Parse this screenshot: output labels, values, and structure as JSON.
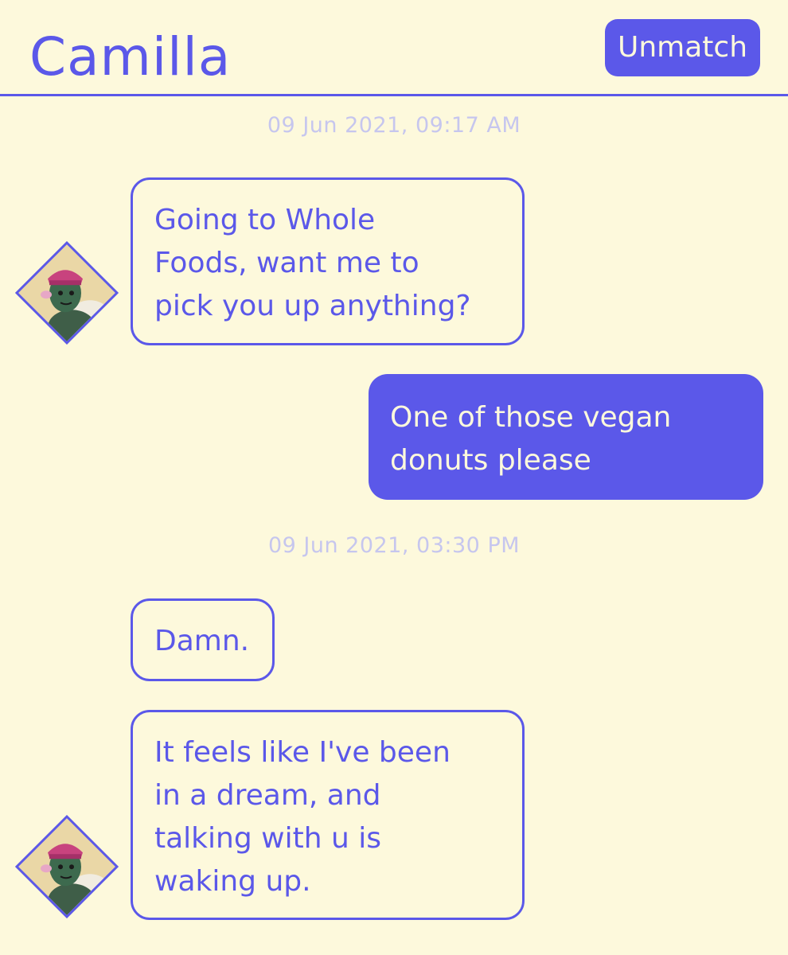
{
  "header": {
    "contact_name": "Camilla",
    "unmatch_label": "Unmatch"
  },
  "colors": {
    "accent": "#5b58e9",
    "background": "#fdf9dc",
    "timestamp": "#c6c6ee"
  },
  "conversation": {
    "timestamps": [
      "09 Jun 2021, 09:17 AM",
      "09 Jun 2021, 03:30 PM"
    ],
    "messages": [
      {
        "sender": "Camilla",
        "direction": "incoming",
        "text": "Going to Whole\nFoods, want me to\npick you up anything?"
      },
      {
        "sender": "me",
        "direction": "outgoing",
        "text": "One of those vegan\ndonuts please"
      },
      {
        "sender": "Camilla",
        "direction": "incoming",
        "text": "Damn."
      },
      {
        "sender": "Camilla",
        "direction": "incoming",
        "text": "It feels like I've been\nin a dream, and\ntalking with u is\nwaking up."
      }
    ]
  },
  "avatar_icon": "character-avatar-icon"
}
